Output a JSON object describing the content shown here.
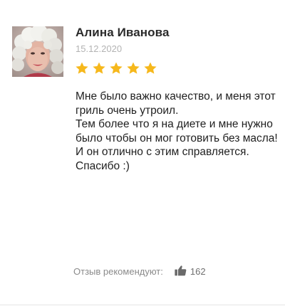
{
  "review": {
    "author": "Алина Иванова",
    "date": "15.12.2020",
    "rating": 5,
    "rating_max": 5,
    "star_color": "#f6b81c",
    "avatar_icon": "user-avatar-photo",
    "text_lines": [
      "Мне было важно качество, и меня этот гриль очень утроил.",
      "Тем более что я на диете и мне нужно было чтобы он мог готовить без масла!",
      "И он отлично с этим справляется.",
      "Спасибо :)"
    ]
  },
  "recommend": {
    "label": "Отзыв рекомендуют:",
    "icon": "thumbs-up-icon",
    "count": "162"
  }
}
